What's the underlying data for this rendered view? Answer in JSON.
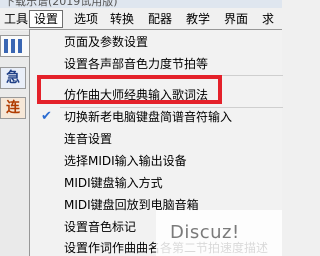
{
  "window": {
    "title_fragment": "下载乐谱(2019试用版)"
  },
  "menubar": {
    "items": [
      {
        "label": "工具",
        "active": false
      },
      {
        "label": "设置",
        "active": true
      },
      {
        "label": "选项",
        "active": false
      },
      {
        "label": "转换",
        "active": false
      },
      {
        "label": "配器",
        "active": false
      },
      {
        "label": "教学",
        "active": false
      },
      {
        "label": "界面",
        "active": false
      },
      {
        "label": "求",
        "active": false
      }
    ]
  },
  "toolbar": {
    "item_a": "急",
    "item_b": "连"
  },
  "settings_menu": {
    "items": [
      {
        "label": "页面及参数设置"
      },
      {
        "label": "设置各声部音色力度节拍等"
      },
      {
        "label": "仿作曲大师经典输入歌词法",
        "highlighted": true
      },
      {
        "label": "切换新老电脑键盘简谱音符输入",
        "checked": true
      },
      {
        "label": "连音设置"
      },
      {
        "label": "选择MIDI输入输出设备"
      },
      {
        "label": "MIDI键盘输入方式"
      },
      {
        "label": "MIDI键盘回放到电脑音箱"
      },
      {
        "label": "设置音色标记"
      },
      {
        "label": "设置作词作曲曲名各第二节拍速度描述"
      }
    ]
  },
  "watermark": {
    "text": "Discuz!"
  },
  "colors": {
    "highlight_border": "#e4212a",
    "check": "#2a6bd1"
  },
  "icons": [
    "check-icon"
  ]
}
